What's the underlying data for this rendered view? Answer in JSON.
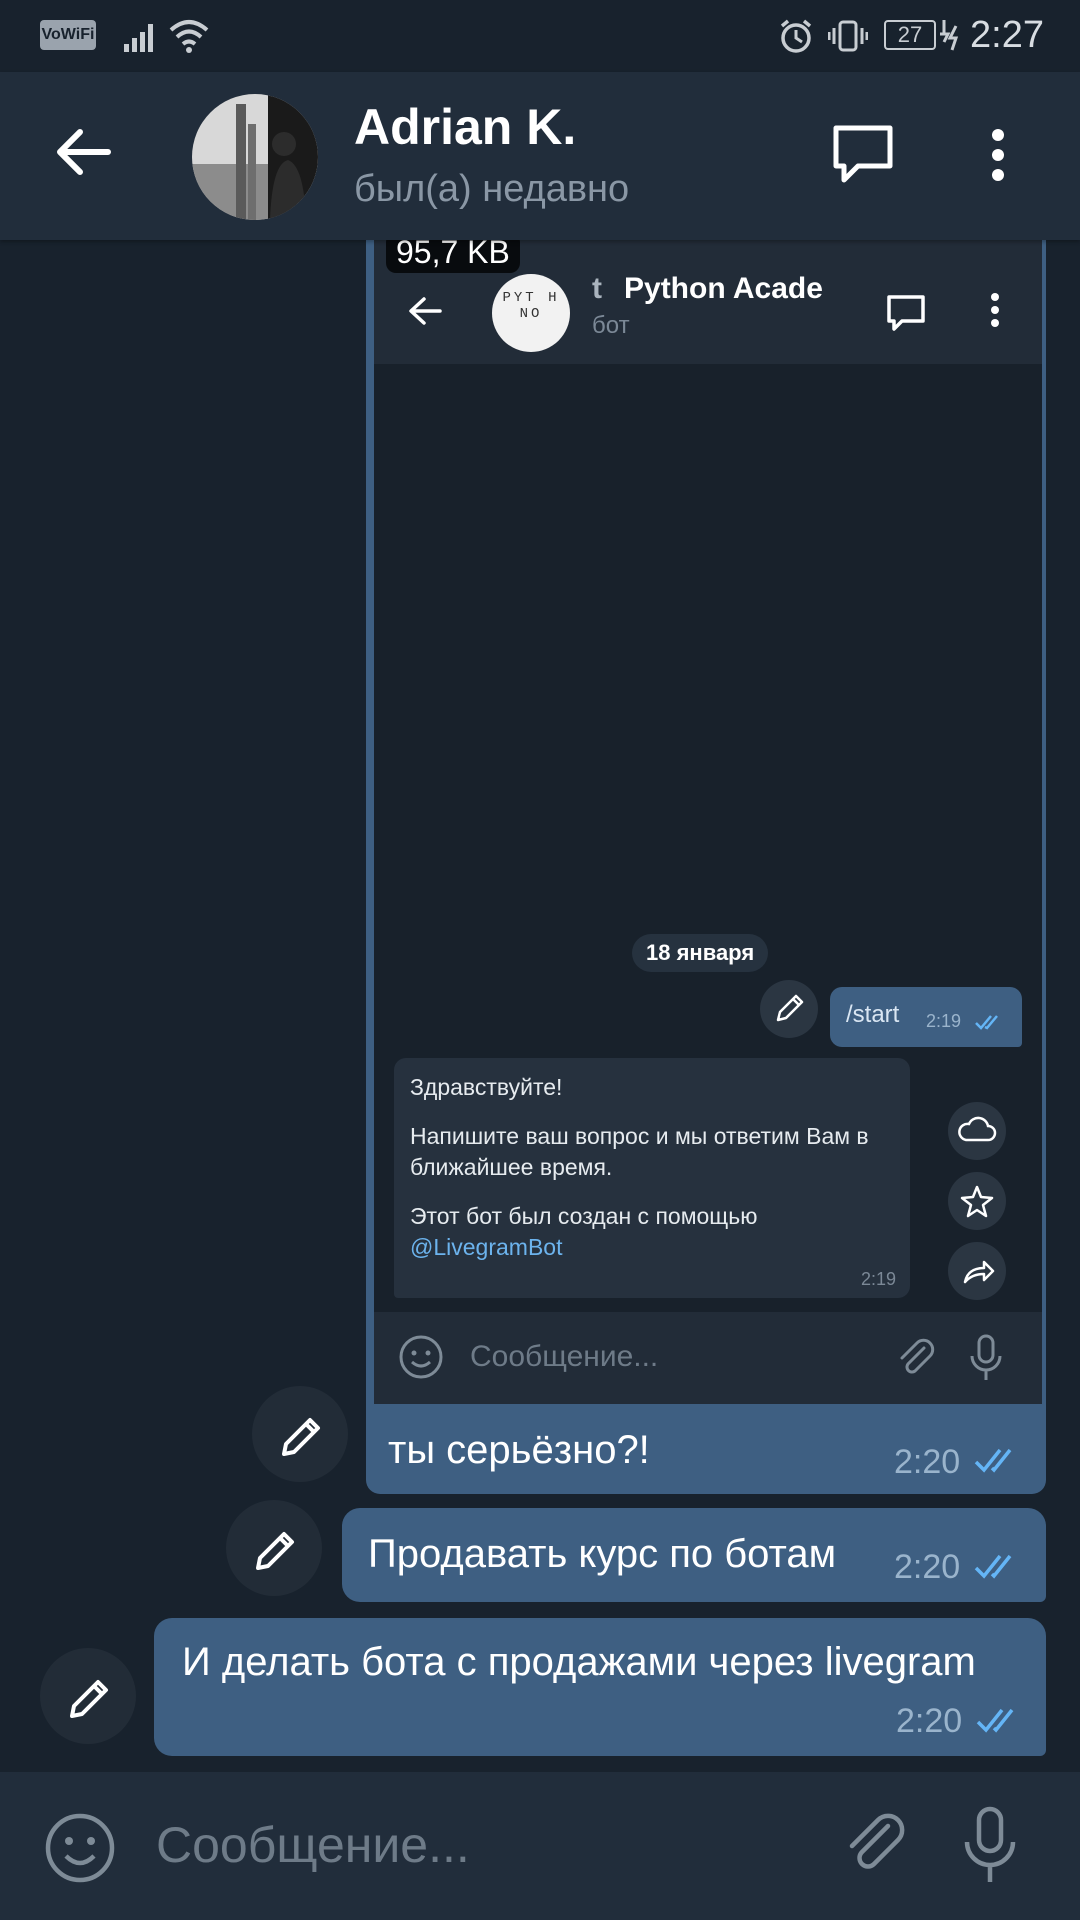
{
  "status_bar": {
    "vowifi": "VoWiFi",
    "battery": "27",
    "time": "2:27"
  },
  "header": {
    "title": "Adrian K.",
    "subtitle": "был(а) недавно"
  },
  "screenshot_message": {
    "file_size": "95,7 KB",
    "inner": {
      "avatar_text": "PYT H NO",
      "title": "Python Academy",
      "title_prefix": "t",
      "subtitle": "бот",
      "date_chip": "18 января",
      "outgoing": {
        "text": "/start",
        "time": "2:19"
      },
      "incoming": {
        "line1": "Здравствуйте!",
        "line2": "Напишите ваш вопрос и мы ответим Вам в ближайшее время.",
        "line3": "Этот бот был создан с помощью",
        "link": "@LivegramBot",
        "time": "2:19"
      },
      "input_placeholder": "Сообщение..."
    }
  },
  "messages": [
    {
      "text": "ты серьёзно?!",
      "time": "2:20"
    },
    {
      "text": "Продавать курс по ботам",
      "time": "2:20"
    },
    {
      "text": "И делать бота с продажами через livegram",
      "time": "2:20"
    }
  ],
  "input": {
    "placeholder": "Сообщение..."
  },
  "colors": {
    "background": "#18222d",
    "header": "#212d3b",
    "bubble_out": "#3e5f82",
    "time_color": "#9ab4cc",
    "tick_color": "#64b5f6"
  }
}
